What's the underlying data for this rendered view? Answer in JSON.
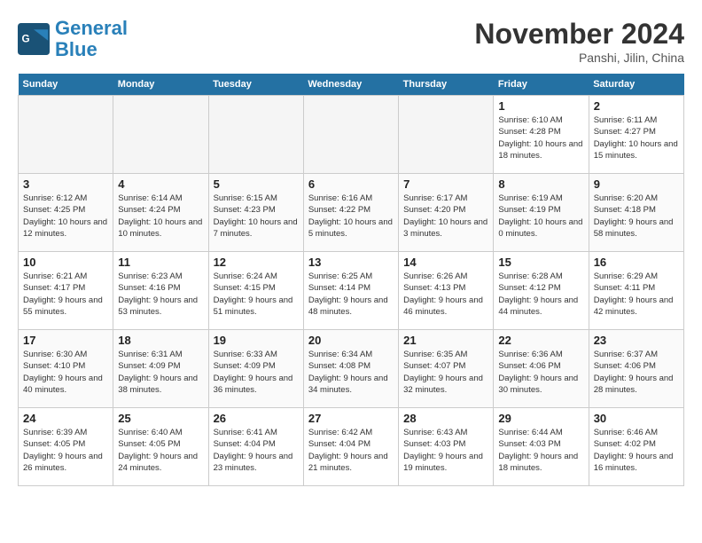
{
  "header": {
    "logo_line1": "General",
    "logo_line2": "Blue",
    "month": "November 2024",
    "location": "Panshi, Jilin, China"
  },
  "weekdays": [
    "Sunday",
    "Monday",
    "Tuesday",
    "Wednesday",
    "Thursday",
    "Friday",
    "Saturday"
  ],
  "weeks": [
    [
      {
        "day": "",
        "info": ""
      },
      {
        "day": "",
        "info": ""
      },
      {
        "day": "",
        "info": ""
      },
      {
        "day": "",
        "info": ""
      },
      {
        "day": "",
        "info": ""
      },
      {
        "day": "1",
        "info": "Sunrise: 6:10 AM\nSunset: 4:28 PM\nDaylight: 10 hours and 18 minutes."
      },
      {
        "day": "2",
        "info": "Sunrise: 6:11 AM\nSunset: 4:27 PM\nDaylight: 10 hours and 15 minutes."
      }
    ],
    [
      {
        "day": "3",
        "info": "Sunrise: 6:12 AM\nSunset: 4:25 PM\nDaylight: 10 hours and 12 minutes."
      },
      {
        "day": "4",
        "info": "Sunrise: 6:14 AM\nSunset: 4:24 PM\nDaylight: 10 hours and 10 minutes."
      },
      {
        "day": "5",
        "info": "Sunrise: 6:15 AM\nSunset: 4:23 PM\nDaylight: 10 hours and 7 minutes."
      },
      {
        "day": "6",
        "info": "Sunrise: 6:16 AM\nSunset: 4:22 PM\nDaylight: 10 hours and 5 minutes."
      },
      {
        "day": "7",
        "info": "Sunrise: 6:17 AM\nSunset: 4:20 PM\nDaylight: 10 hours and 3 minutes."
      },
      {
        "day": "8",
        "info": "Sunrise: 6:19 AM\nSunset: 4:19 PM\nDaylight: 10 hours and 0 minutes."
      },
      {
        "day": "9",
        "info": "Sunrise: 6:20 AM\nSunset: 4:18 PM\nDaylight: 9 hours and 58 minutes."
      }
    ],
    [
      {
        "day": "10",
        "info": "Sunrise: 6:21 AM\nSunset: 4:17 PM\nDaylight: 9 hours and 55 minutes."
      },
      {
        "day": "11",
        "info": "Sunrise: 6:23 AM\nSunset: 4:16 PM\nDaylight: 9 hours and 53 minutes."
      },
      {
        "day": "12",
        "info": "Sunrise: 6:24 AM\nSunset: 4:15 PM\nDaylight: 9 hours and 51 minutes."
      },
      {
        "day": "13",
        "info": "Sunrise: 6:25 AM\nSunset: 4:14 PM\nDaylight: 9 hours and 48 minutes."
      },
      {
        "day": "14",
        "info": "Sunrise: 6:26 AM\nSunset: 4:13 PM\nDaylight: 9 hours and 46 minutes."
      },
      {
        "day": "15",
        "info": "Sunrise: 6:28 AM\nSunset: 4:12 PM\nDaylight: 9 hours and 44 minutes."
      },
      {
        "day": "16",
        "info": "Sunrise: 6:29 AM\nSunset: 4:11 PM\nDaylight: 9 hours and 42 minutes."
      }
    ],
    [
      {
        "day": "17",
        "info": "Sunrise: 6:30 AM\nSunset: 4:10 PM\nDaylight: 9 hours and 40 minutes."
      },
      {
        "day": "18",
        "info": "Sunrise: 6:31 AM\nSunset: 4:09 PM\nDaylight: 9 hours and 38 minutes."
      },
      {
        "day": "19",
        "info": "Sunrise: 6:33 AM\nSunset: 4:09 PM\nDaylight: 9 hours and 36 minutes."
      },
      {
        "day": "20",
        "info": "Sunrise: 6:34 AM\nSunset: 4:08 PM\nDaylight: 9 hours and 34 minutes."
      },
      {
        "day": "21",
        "info": "Sunrise: 6:35 AM\nSunset: 4:07 PM\nDaylight: 9 hours and 32 minutes."
      },
      {
        "day": "22",
        "info": "Sunrise: 6:36 AM\nSunset: 4:06 PM\nDaylight: 9 hours and 30 minutes."
      },
      {
        "day": "23",
        "info": "Sunrise: 6:37 AM\nSunset: 4:06 PM\nDaylight: 9 hours and 28 minutes."
      }
    ],
    [
      {
        "day": "24",
        "info": "Sunrise: 6:39 AM\nSunset: 4:05 PM\nDaylight: 9 hours and 26 minutes."
      },
      {
        "day": "25",
        "info": "Sunrise: 6:40 AM\nSunset: 4:05 PM\nDaylight: 9 hours and 24 minutes."
      },
      {
        "day": "26",
        "info": "Sunrise: 6:41 AM\nSunset: 4:04 PM\nDaylight: 9 hours and 23 minutes."
      },
      {
        "day": "27",
        "info": "Sunrise: 6:42 AM\nSunset: 4:04 PM\nDaylight: 9 hours and 21 minutes."
      },
      {
        "day": "28",
        "info": "Sunrise: 6:43 AM\nSunset: 4:03 PM\nDaylight: 9 hours and 19 minutes."
      },
      {
        "day": "29",
        "info": "Sunrise: 6:44 AM\nSunset: 4:03 PM\nDaylight: 9 hours and 18 minutes."
      },
      {
        "day": "30",
        "info": "Sunrise: 6:46 AM\nSunset: 4:02 PM\nDaylight: 9 hours and 16 minutes."
      }
    ]
  ]
}
